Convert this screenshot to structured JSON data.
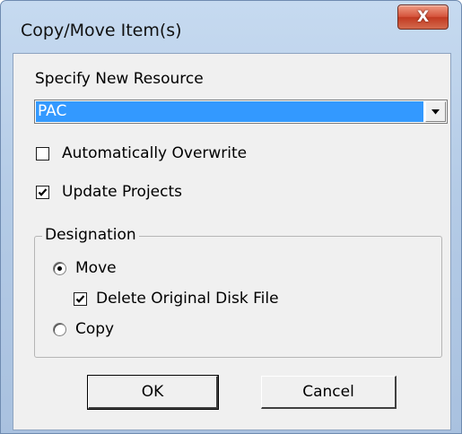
{
  "window": {
    "title": "Copy/Move Item(s)",
    "close_symbol": "X"
  },
  "resource": {
    "label": "Specify New Resource",
    "selected_value": "PAC"
  },
  "options": {
    "auto_overwrite": {
      "label": "Automatically Overwrite",
      "checked": false
    },
    "update_projects": {
      "label": "Update Projects",
      "checked": true
    }
  },
  "designation": {
    "legend": "Designation",
    "move": {
      "label": "Move",
      "selected": true
    },
    "delete_original": {
      "label": "Delete Original Disk File",
      "checked": true
    },
    "copy": {
      "label": "Copy",
      "selected": false
    }
  },
  "buttons": {
    "ok": "OK",
    "cancel": "Cancel"
  },
  "icons": {
    "close": "close-icon",
    "dropdown": "chevron-down-icon",
    "check": "checkmark-icon"
  },
  "colors": {
    "selection": "#3399ff",
    "close_button": "#c94a32",
    "dialog_face": "#f0f0f0",
    "frame": "#b4cbe6"
  }
}
